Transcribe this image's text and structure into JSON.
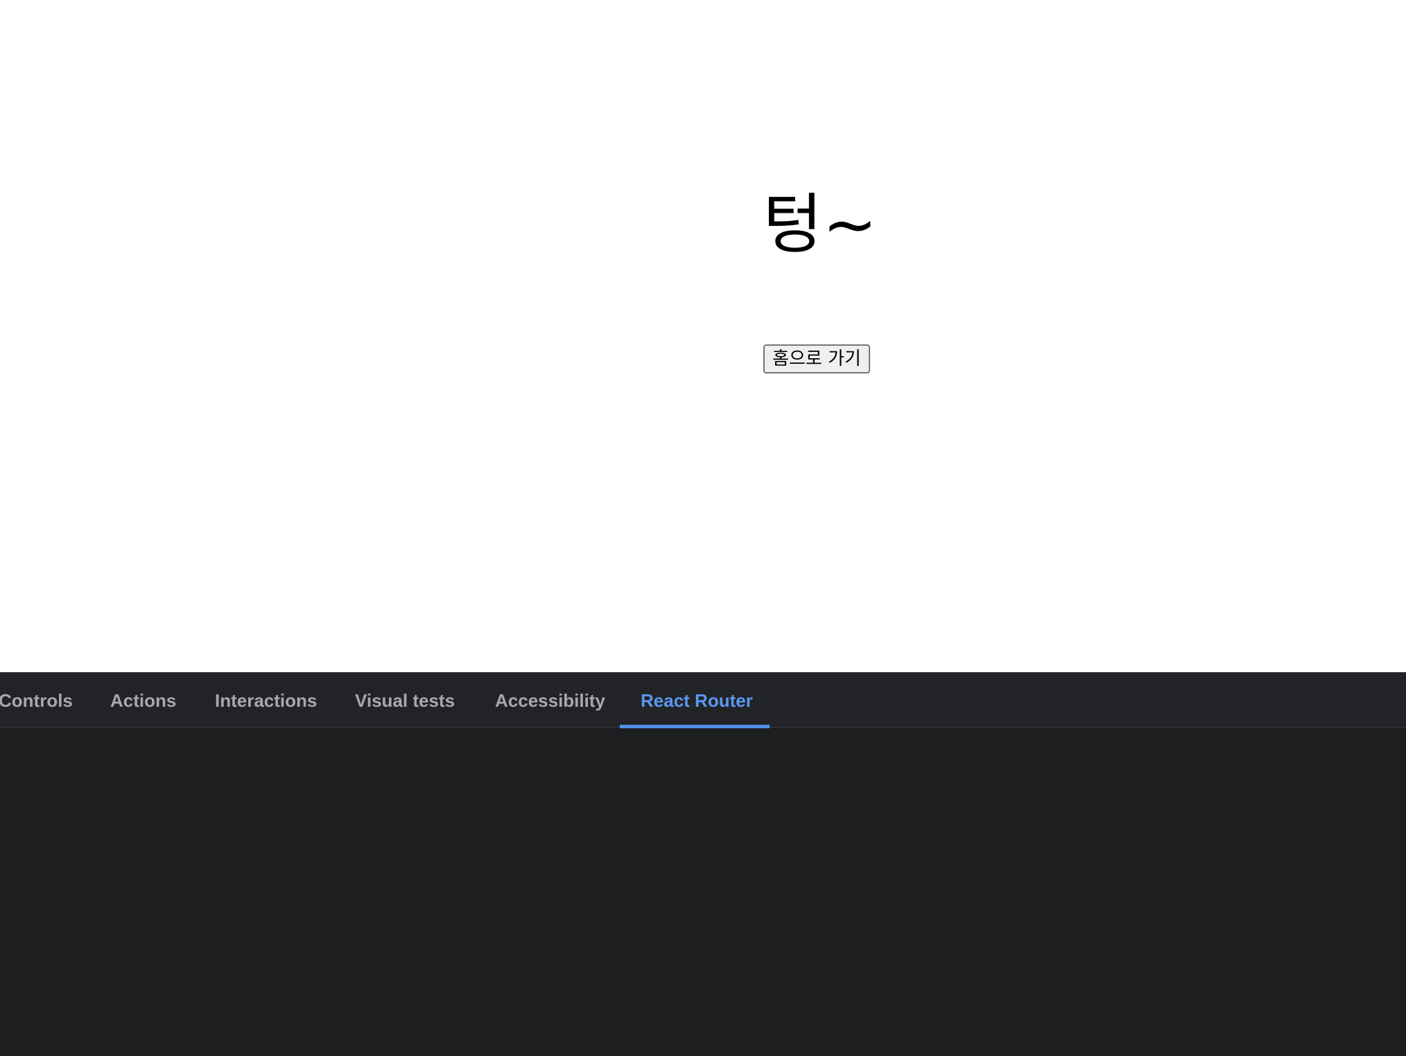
{
  "preview": {
    "title": "텅~",
    "home_button_label": "홈으로 가기"
  },
  "addons": {
    "tabs": [
      {
        "label": "Controls",
        "active": false
      },
      {
        "label": "Actions",
        "active": false
      },
      {
        "label": "Interactions",
        "active": false
      },
      {
        "label": "Visual tests",
        "active": false
      },
      {
        "label": "Accessibility",
        "active": false
      },
      {
        "label": "React Router",
        "active": true
      }
    ],
    "colors": {
      "active_tab": "#5a97ee",
      "inactive_tab": "#a6a8ad",
      "panel_background": "#1d1e20",
      "tabbar_background": "#222327"
    }
  }
}
